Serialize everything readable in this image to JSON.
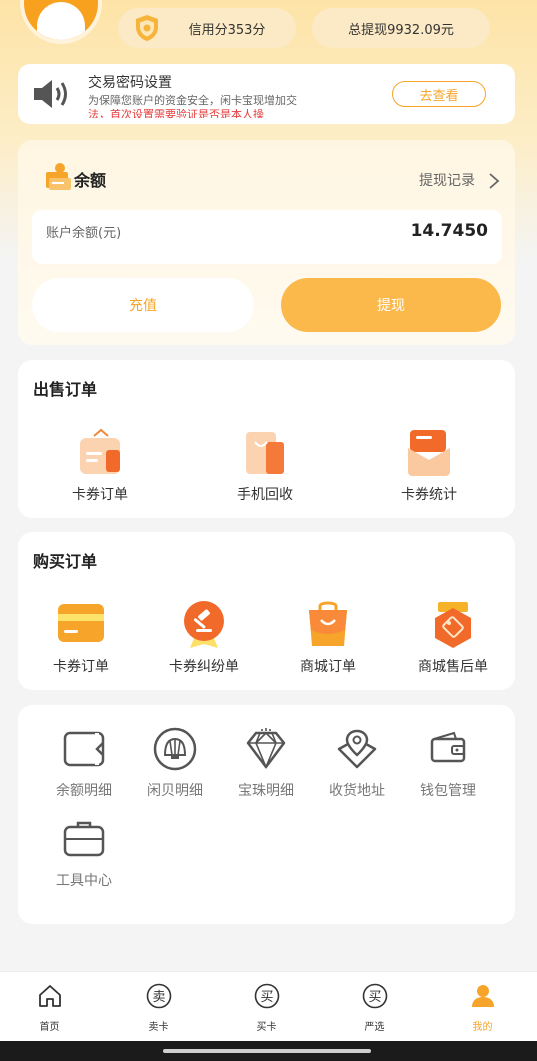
{
  "header": {
    "credit_label": "信用分353分",
    "total_withdraw_label": "总提现9932.09元"
  },
  "notice": {
    "title": "交易密码设置",
    "description": "为保障您账户的资金安全，闲卡宝现增加交",
    "description_cut": "法，首次设置需要验证是否是本人操",
    "button": "去查看"
  },
  "balance": {
    "title": "余额",
    "record_link": "提现记录",
    "account_label": "账户余额(元)",
    "amount": "14.7450",
    "recharge_button": "充值",
    "withdraw_button": "提现"
  },
  "sell_orders": {
    "title": "出售订单",
    "items": [
      {
        "label": "卡券订单",
        "icon": "coupon-bag-icon"
      },
      {
        "label": "手机回收",
        "icon": "phone-bag-icon"
      },
      {
        "label": "卡券统计",
        "icon": "envelope-icon"
      }
    ]
  },
  "buy_orders": {
    "title": "购买订单",
    "items": [
      {
        "label": "卡券订单",
        "icon": "card-icon"
      },
      {
        "label": "卡券纠纷单",
        "icon": "gavel-medal-icon"
      },
      {
        "label": "商城订单",
        "icon": "shopping-bag-icon"
      },
      {
        "label": "商城售后单",
        "icon": "tag-shield-icon"
      }
    ]
  },
  "tools": {
    "items": [
      {
        "label": "余额明细",
        "icon": "wallet-card-icon"
      },
      {
        "label": "闲贝明细",
        "icon": "shell-icon"
      },
      {
        "label": "宝珠明细",
        "icon": "diamond-icon"
      },
      {
        "label": "收货地址",
        "icon": "map-pin-icon"
      },
      {
        "label": "钱包管理",
        "icon": "wallet-icon"
      },
      {
        "label": "工具中心",
        "icon": "toolbox-icon"
      }
    ]
  },
  "tabbar": {
    "tabs": [
      {
        "label": "首页",
        "glyph": ""
      },
      {
        "label": "卖卡",
        "glyph": "卖"
      },
      {
        "label": "买卡",
        "glyph": "买"
      },
      {
        "label": "严选",
        "glyph": "买"
      },
      {
        "label": "我的",
        "glyph": ""
      }
    ],
    "active_color": "#f6a52a"
  },
  "colors": {
    "accent": "#f6a52a",
    "withdraw_button": "#fbb84b",
    "warning_text": "#e53c3c"
  }
}
